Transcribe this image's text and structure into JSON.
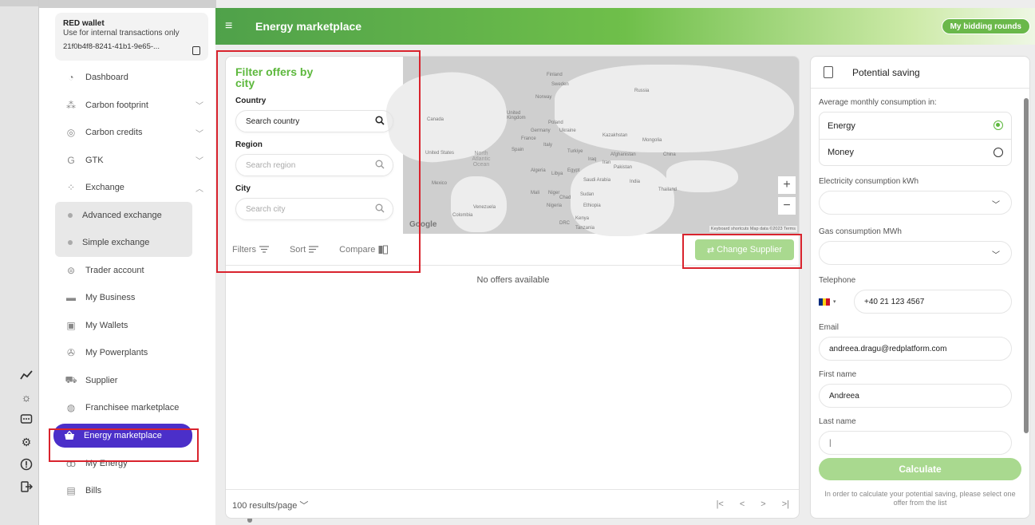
{
  "wallet": {
    "title": "RED wallet",
    "subtitle": "Use for internal transactions only",
    "id": "21f0b4f8-8241-41b1-9e65-..."
  },
  "sidebar": {
    "items": [
      {
        "label": "Dashboard",
        "icon": "dashboard-icon"
      },
      {
        "label": "Carbon footprint",
        "icon": "footprint-icon",
        "chevron": "down"
      },
      {
        "label": "Carbon credits",
        "icon": "credits-icon",
        "chevron": "down"
      },
      {
        "label": "GTK",
        "icon": "gtk-icon",
        "chevron": "down"
      },
      {
        "label": "Exchange",
        "icon": "exchange-icon",
        "chevron": "up"
      }
    ],
    "exchange_sub": [
      {
        "label": "Advanced exchange"
      },
      {
        "label": "Simple exchange"
      }
    ],
    "items2": [
      {
        "label": "Trader account",
        "icon": "trader-icon"
      },
      {
        "label": "My Business",
        "icon": "briefcase-icon"
      },
      {
        "label": "My Wallets",
        "icon": "wallet-icon"
      },
      {
        "label": "My Powerplants",
        "icon": "powerplant-icon"
      },
      {
        "label": "Supplier",
        "icon": "truck-icon"
      },
      {
        "label": "Franchisee marketplace",
        "icon": "franchise-icon"
      },
      {
        "label": "Energy marketplace",
        "icon": "basket-icon",
        "active": true
      },
      {
        "label": "My Energy",
        "icon": "energy-icon"
      },
      {
        "label": "Bills",
        "icon": "bills-icon"
      }
    ]
  },
  "header": {
    "title": "Energy marketplace",
    "bidding_button": "My bidding rounds"
  },
  "filter": {
    "title": "Filter offers by city",
    "country_label": "Country",
    "country_value": "Search country",
    "region_label": "Region",
    "region_placeholder": "Search region",
    "city_label": "City",
    "city_placeholder": "Search city"
  },
  "map": {
    "labels": [
      "Finland",
      "Sweden",
      "Norway",
      "Russia",
      "United Kingdom",
      "Poland",
      "Germany",
      "Ukraine",
      "Kazakhstan",
      "Mongolia",
      "France",
      "Italy",
      "Spain",
      "Turkiye",
      "Canada",
      "United States",
      "North Atlantic Ocean",
      "Mexico",
      "Algeria",
      "Libya",
      "Egypt",
      "Iraq",
      "Iran",
      "Afghanistan",
      "Pakistan",
      "China",
      "Saudi Arabia",
      "India",
      "Thailand",
      "Mali",
      "Niger",
      "Chad",
      "Sudan",
      "Nigeria",
      "Ethiopia",
      "Venezuela",
      "Colombia",
      "DRC",
      "Kenya",
      "Tanzania"
    ],
    "google": "Google",
    "attribution": "Keyboard shortcuts   Map data ©2023   Terms"
  },
  "toolbar": {
    "filters": "Filters",
    "sort": "Sort",
    "compare": "Compare",
    "change_supplier": "Change Supplier"
  },
  "offers": {
    "empty": "No offers available"
  },
  "footer": {
    "results_per_page": "100 results/page"
  },
  "right_panel": {
    "title": "Potential saving",
    "avg_label": "Average monthly consumption in:",
    "options": [
      {
        "label": "Energy",
        "selected": true
      },
      {
        "label": "Money",
        "selected": false
      }
    ],
    "electricity_label": "Electricity consumption kWh",
    "gas_label": "Gas consumption MWh",
    "telephone_label": "Telephone",
    "telephone_value": "+40 21 123 4567",
    "email_label": "Email",
    "email_value": "andreea.dragu@redplatform.com",
    "first_name_label": "First name",
    "first_name_value": "Andreea",
    "last_name_label": "Last name",
    "last_name_value": "|",
    "calculate": "Calculate",
    "note": "In order to calculate your potential saving, please select one offer from the list"
  },
  "colors": {
    "accent_green": "#5db83d",
    "active_purple": "#4b2fc9",
    "highlight_red": "#d9232d"
  }
}
